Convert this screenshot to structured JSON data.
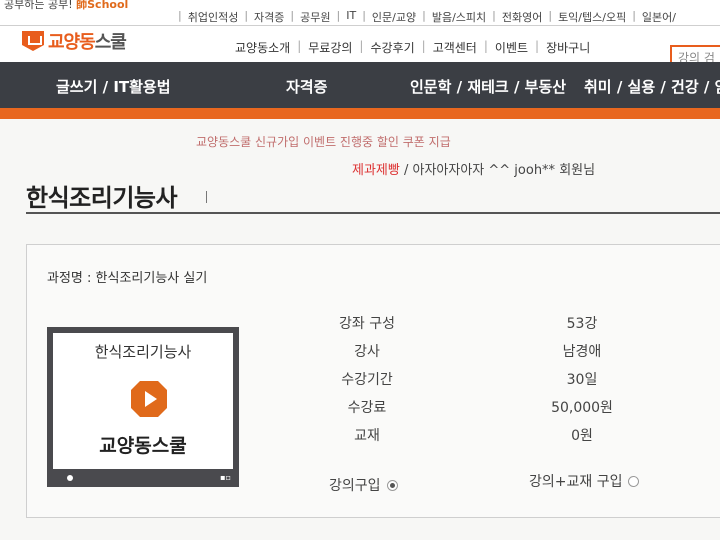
{
  "topbar": {
    "promo_text": "공부하는 공부! ",
    "promo_brand": "師School",
    "links": [
      "취업인적성",
      "자격증",
      "공무원",
      "IT",
      "인문/교양",
      "발음/스피치",
      "전화영어",
      "토익/텝스/오픽",
      "일본어/"
    ]
  },
  "header": {
    "logo_main": "교양동",
    "logo_tail": "스쿨",
    "menu": [
      "교양동소개",
      "무료강의",
      "수강후기",
      "고객센터",
      "이벤트",
      "장바구니"
    ],
    "search_placeholder": "강의 검"
  },
  "categories": [
    "글쓰기 / IT활용법",
    "자격증",
    "인문학 / 재테크 / 부동산",
    "취미 / 실용 / 건강 / 암"
  ],
  "ticker": {
    "line1": "교양동스쿨 신규가입 이벤트 진행중 할인 쿠폰 지급",
    "line2_brand": "제과제빵",
    "line2_text": " / 아자아자아자 ^^ jooh** 회원님"
  },
  "page": {
    "title": "한식조리기능사"
  },
  "course": {
    "name": "과정명 : 한식조리기능사 실기",
    "thumbnail_title": "한식조리기능사",
    "thumbnail_brand": "교양동스쿨",
    "info": [
      {
        "label": "강좌 구성",
        "value": "53강"
      },
      {
        "label": "강사",
        "value": "남경애"
      },
      {
        "label": "수강기간",
        "value": "30일"
      },
      {
        "label": "수강료",
        "value": "50,000원"
      },
      {
        "label": "교재",
        "value": "0원"
      }
    ],
    "purchase_options": [
      {
        "label": "강의구입",
        "selected": true
      },
      {
        "label": "강의+교재 구입",
        "selected": false
      }
    ]
  },
  "colors": {
    "accent": "#e8671f",
    "nav_bg": "#3b3e44"
  },
  "icons": {
    "logo": "logo-icon",
    "play": "play-icon"
  }
}
